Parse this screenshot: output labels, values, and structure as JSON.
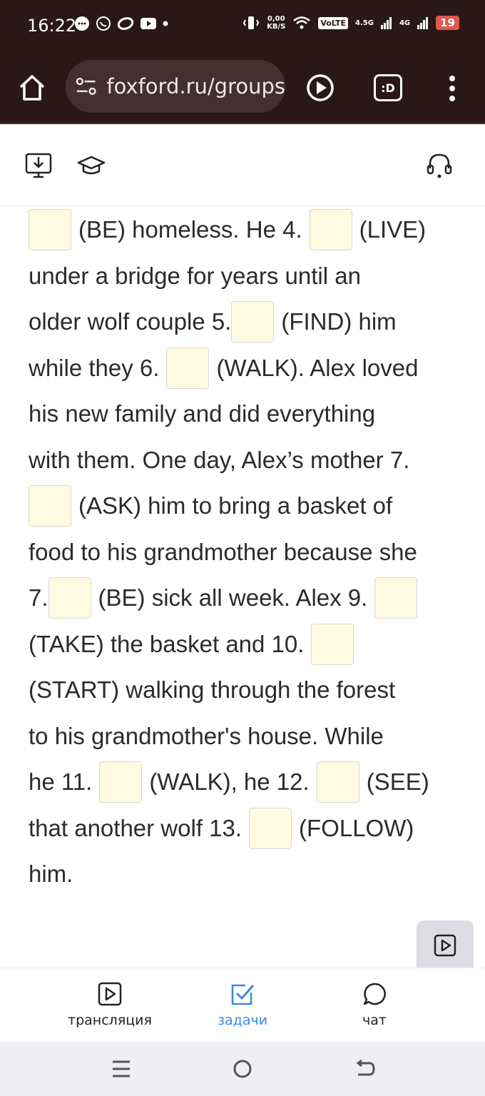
{
  "status_bar": {
    "time": "16:22",
    "speed_top": "0,00",
    "speed_bottom": "KB/S",
    "volte": "VoLTE",
    "network1": "4.5G",
    "network2": "4G",
    "battery": "19"
  },
  "browser": {
    "url": "foxford.ru/groups",
    "tab_badge": ":D"
  },
  "exercise": {
    "lines": [
      {
        "seg1": "",
        "blank_before": true,
        "text_a": "(BE) homeless. He 4.",
        "blank_mid": true,
        "text_b": "(LIVE)"
      },
      {
        "text": "under a bridge for years until an"
      },
      {
        "text_a": "older wolf couple 5.",
        "text_b": "(FIND) him"
      },
      {
        "text_a": "while they 6.",
        "text_b": "(WALK). Alex loved"
      },
      {
        "text": "his new family and did everything"
      },
      {
        "text": "with them. One day, Alex’s mother 7."
      },
      {
        "text_b": "(ASK) him to bring a basket of"
      },
      {
        "text": "food to his grandmother because she"
      },
      {
        "text_a": "7.",
        "text_b": "(BE) sick all week. Alex 9."
      },
      {
        "text_a": "(TAKE) the basket and 10."
      },
      {
        "text": "(START) walking through the forest"
      },
      {
        "text": "to his grandmother's house. While"
      },
      {
        "text_a": "he 11.",
        "text_b": "(WALK), he 12.",
        "text_c": "(SEE)"
      },
      {
        "text_a": "that another wolf 13.",
        "text_b": "(FOLLOW)"
      },
      {
        "text": "him."
      }
    ]
  },
  "bottom_nav": {
    "broadcast": "трансляция",
    "tasks": "задачи",
    "chat": "чат"
  },
  "colors": {
    "accent": "#3a8be0",
    "blank_fill": "#fffbe0",
    "browser_bg": "#2a1818"
  }
}
